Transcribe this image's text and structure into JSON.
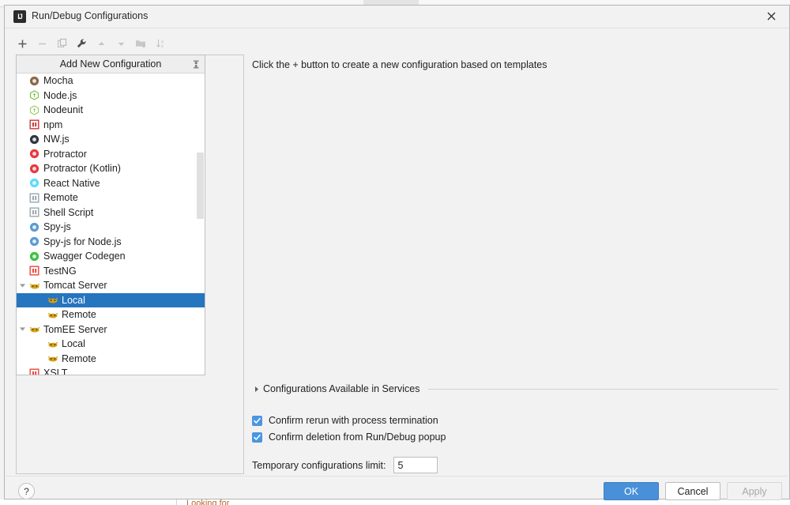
{
  "window": {
    "title": "Run/Debug Configurations",
    "app_icon": "intellij-idea-icon",
    "close_icon": "close-icon"
  },
  "background": {
    "bottom_text": "Looking for"
  },
  "toolbar": {
    "buttons": [
      {
        "name": "add-configuration-button",
        "icon": "plus-icon",
        "enabled": true
      },
      {
        "name": "remove-configuration-button",
        "icon": "minus-icon",
        "enabled": false
      },
      {
        "name": "copy-configuration-button",
        "icon": "copy-icon",
        "enabled": false
      },
      {
        "name": "edit-templates-button",
        "icon": "wrench-icon",
        "enabled": true
      },
      {
        "name": "move-up-button",
        "icon": "arrow-up-icon",
        "enabled": false
      },
      {
        "name": "move-down-button",
        "icon": "arrow-down-icon",
        "enabled": false
      },
      {
        "name": "create-folder-button",
        "icon": "folder-add-icon",
        "enabled": false
      },
      {
        "name": "sort-configurations-button",
        "icon": "sort-az-icon",
        "enabled": false
      }
    ]
  },
  "list": {
    "header_label": "Add New Configuration",
    "header_sort_icon": "collapse-expand-icon",
    "items": [
      {
        "label": "Mocha",
        "icon": "mocha-icon",
        "icon_color": "#8d6748",
        "shape": "circle",
        "indent": 0,
        "twisty": "",
        "selected": false
      },
      {
        "label": "Node.js",
        "icon": "nodejs-icon",
        "icon_color": "#83c24a",
        "shape": "hex",
        "indent": 0,
        "twisty": "",
        "selected": false
      },
      {
        "label": "Nodeunit",
        "icon": "nodeunit-icon",
        "icon_color": "#9ccf6b",
        "shape": "hex",
        "indent": 0,
        "twisty": "",
        "selected": false
      },
      {
        "label": "npm",
        "icon": "npm-icon",
        "icon_color": "#cb3837",
        "shape": "square",
        "indent": 0,
        "twisty": "",
        "selected": false
      },
      {
        "label": "NW.js",
        "icon": "nwjs-icon",
        "icon_color": "#2f3640",
        "shape": "circle",
        "indent": 0,
        "twisty": "",
        "selected": false
      },
      {
        "label": "Protractor",
        "icon": "protractor-icon",
        "icon_color": "#e8393c",
        "shape": "circle",
        "indent": 0,
        "twisty": "",
        "selected": false
      },
      {
        "label": "Protractor (Kotlin)",
        "icon": "protractor-kotlin-icon",
        "icon_color": "#e8393c",
        "shape": "circle",
        "indent": 0,
        "twisty": "",
        "selected": false
      },
      {
        "label": "React Native",
        "icon": "react-native-icon",
        "icon_color": "#61dafb",
        "shape": "circle",
        "indent": 0,
        "twisty": "",
        "selected": false
      },
      {
        "label": "Remote",
        "icon": "remote-icon",
        "icon_color": "#9aa7b0",
        "shape": "square",
        "indent": 0,
        "twisty": "",
        "selected": false
      },
      {
        "label": "Shell Script",
        "icon": "shell-script-icon",
        "icon_color": "#9aa7b0",
        "shape": "square",
        "indent": 0,
        "twisty": "",
        "selected": false
      },
      {
        "label": "Spy-js",
        "icon": "spy-js-icon",
        "icon_color": "#5b9bd5",
        "shape": "circle",
        "indent": 0,
        "twisty": "",
        "selected": false
      },
      {
        "label": "Spy-js for Node.js",
        "icon": "spy-js-node-icon",
        "icon_color": "#5b9bd5",
        "shape": "circle",
        "indent": 0,
        "twisty": "",
        "selected": false
      },
      {
        "label": "Swagger Codegen",
        "icon": "swagger-codegen-icon",
        "icon_color": "#3ec13e",
        "shape": "circle",
        "indent": 0,
        "twisty": "",
        "selected": false
      },
      {
        "label": "TestNG",
        "icon": "testng-icon",
        "icon_color": "#e8493c",
        "shape": "square",
        "indent": 0,
        "twisty": "",
        "selected": false
      },
      {
        "label": "Tomcat Server",
        "icon": "tomcat-icon",
        "icon_color": "#d4a017",
        "shape": "cat",
        "indent": 0,
        "twisty": "expanded",
        "selected": false
      },
      {
        "label": "Local",
        "icon": "tomcat-local-icon",
        "icon_color": "#d4a017",
        "shape": "cat",
        "indent": 1,
        "twisty": "",
        "selected": true
      },
      {
        "label": "Remote",
        "icon": "tomcat-remote-icon",
        "icon_color": "#d4a017",
        "shape": "cat",
        "indent": 1,
        "twisty": "",
        "selected": false
      },
      {
        "label": "TomEE Server",
        "icon": "tomee-icon",
        "icon_color": "#d4a017",
        "shape": "cat",
        "indent": 0,
        "twisty": "expanded",
        "selected": false
      },
      {
        "label": "Local",
        "icon": "tomee-local-icon",
        "icon_color": "#d4a017",
        "shape": "cat",
        "indent": 1,
        "twisty": "",
        "selected": false
      },
      {
        "label": "Remote",
        "icon": "tomee-remote-icon",
        "icon_color": "#d4a017",
        "shape": "cat",
        "indent": 1,
        "twisty": "",
        "selected": false
      },
      {
        "label": "XSLT",
        "icon": "xslt-icon",
        "icon_color": "#e8493c",
        "shape": "square",
        "indent": 0,
        "twisty": "",
        "selected": false
      }
    ]
  },
  "main": {
    "hint": "Click the + button to create a new configuration based on templates",
    "collapsible": {
      "label": "Configurations Available in Services",
      "arrow_icon": "chevron-right-icon",
      "expanded": false
    },
    "checkboxes": [
      {
        "label": "Confirm rerun with process termination",
        "checked": true
      },
      {
        "label": "Confirm deletion from Run/Debug popup",
        "checked": true
      }
    ],
    "temp_limit": {
      "label": "Temporary configurations limit:",
      "value": "5"
    }
  },
  "footer": {
    "help_label": "?",
    "ok_label": "OK",
    "cancel_label": "Cancel",
    "apply_label": "Apply"
  },
  "colors": {
    "accent": "#4a90d9",
    "selection": "#2675bf",
    "checkbox": "#4a96e2"
  }
}
